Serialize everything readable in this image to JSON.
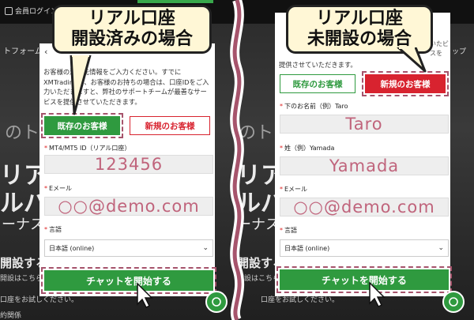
{
  "left": {
    "bg": {
      "login_label": "会員ログイン",
      "platform_text": "トフォーム",
      "big_line1": "のト",
      "big_line2": "リア・",
      "big_line3": "ルパ",
      "big_line4": "ーナス*",
      "open_btn": "開設する",
      "open_link": "開設はこちら",
      "bottom_text": "口座をお試しください。",
      "bottom_text2": "約関係"
    },
    "callout": {
      "line1": "リアル口座",
      "line2": "開設済みの場合"
    },
    "widget": {
      "intro": "お客様の連絡先情報をご入力ください。すでにXMTradingで、お客様のお持ちの場合は、口座IDをご入力いただきますと、弊社のサポートチームが最善なサービスを提供させていただきます。",
      "tab_existing": "既存のお客様",
      "tab_new": "新規のお客様",
      "field1_label": "MT4/MT5 ID（リアル口座）",
      "field1_value": "123456",
      "field2_label": "Eメール",
      "field2_value": "○○@demo.com",
      "field3_label": "言語",
      "field3_value": "日本語 (online)",
      "start_button": "チャットを開始する"
    }
  },
  "right": {
    "bg": {
      "top_right_text": "いたビスを",
      "menu_text": "ップ",
      "big_line1": "のト",
      "big_line2": "リア・",
      "big_line3": "ルパ",
      "big_line4": "ーナス*",
      "open_btn": "開設する",
      "open_link": "開設はこちら",
      "bottom_text": "口座をお試しください。",
      "bottom_text2": "約関係"
    },
    "callout": {
      "line1": "リアル口座",
      "line2": "未開設の場合"
    },
    "widget": {
      "intro": "提供させていただきます。",
      "tab_existing": "既存のお客様",
      "tab_new": "新規のお客様",
      "field1_label": "下のお名前（例）Taro",
      "field1_value": "Taro",
      "field2_label": "姓（例）Yamada",
      "field2_value": "Yamada",
      "field3_label": "Eメール",
      "field3_value": "○○@demo.com",
      "field4_label": "言語",
      "field4_value": "日本語 (online)",
      "start_button": "チャットを開始する"
    }
  },
  "colors": {
    "accent_green": "#2f9a3f",
    "highlight_red": "#d8232f",
    "dash_rose": "#a6546c",
    "field_text": "#c0647c",
    "callout_bg": "#fff7d6"
  }
}
